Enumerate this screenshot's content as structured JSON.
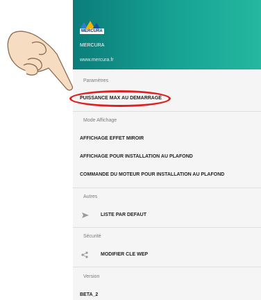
{
  "drawer": {
    "logo_text": "MERCURA",
    "app_name": "MERCURA",
    "app_url": "www.mercura.fr"
  },
  "sections": {
    "parametres": {
      "label": "Paramètres",
      "items": [
        "PUISSANCE MAX AU DEMARRAGE"
      ]
    },
    "mode_affichage": {
      "label": "Mode Affichage",
      "items": [
        "AFFICHAGE EFFET MIROIR",
        "AFFICHAGE POUR INSTALLATION AU PLAFOND",
        "COMMANDE DU MOTEUR POUR INSTALLATION AU PLAFOND"
      ]
    },
    "autres": {
      "label": "Autres",
      "items": [
        "LISTE PAR DEFAUT"
      ]
    },
    "securite": {
      "label": "Sécurité",
      "items": [
        "MODIFIER CLE WEP"
      ]
    },
    "version": {
      "label": "Version",
      "items": [
        "BETA_2"
      ]
    }
  },
  "icons": {
    "autres_row": "send-icon",
    "securite_row": "share-icon"
  },
  "colors": {
    "header_start": "#0b7d7a",
    "header_end": "#25b79f",
    "highlight": "#e02020"
  }
}
